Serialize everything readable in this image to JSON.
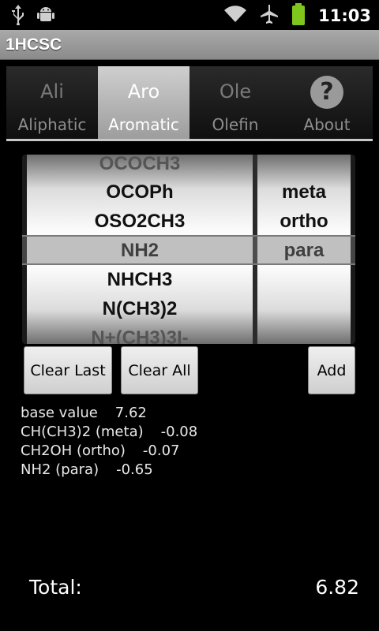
{
  "status_bar": {
    "time": "11:03",
    "icons": [
      "usb-icon",
      "android-icon",
      "wifi-icon",
      "airplane-icon",
      "battery-icon"
    ],
    "battery_color": "#7ec61e"
  },
  "app": {
    "title": "1HCSC"
  },
  "tabs": [
    {
      "abbr": "Ali",
      "label": "Aliphatic",
      "selected": false
    },
    {
      "abbr": "Aro",
      "label": "Aromatic",
      "selected": true
    },
    {
      "abbr": "Ole",
      "label": "Olefin",
      "selected": false
    },
    {
      "abbr": "?",
      "label": "About",
      "selected": false
    }
  ],
  "picker": {
    "substituents": [
      "OCOCH3",
      "OCOPh",
      "OSO2CH3",
      "NH2",
      "NHCH3",
      "N(CH3)2",
      "N+(CH3)3I-"
    ],
    "selected_substituent": "NH2",
    "positions": [
      "meta",
      "ortho",
      "para"
    ],
    "selected_position": "para"
  },
  "buttons": {
    "clear_last": "Clear Last",
    "clear_all": "Clear All",
    "add": "Add"
  },
  "results": [
    {
      "name": "base value",
      "value": "7.62"
    },
    {
      "name": "CH(CH3)2 (meta)",
      "value": "-0.08"
    },
    {
      "name": "CH2OH (ortho)",
      "value": "-0.07"
    },
    {
      "name": "NH2 (para)",
      "value": "-0.65"
    }
  ],
  "total": {
    "label": "Total:",
    "value": "6.82"
  }
}
